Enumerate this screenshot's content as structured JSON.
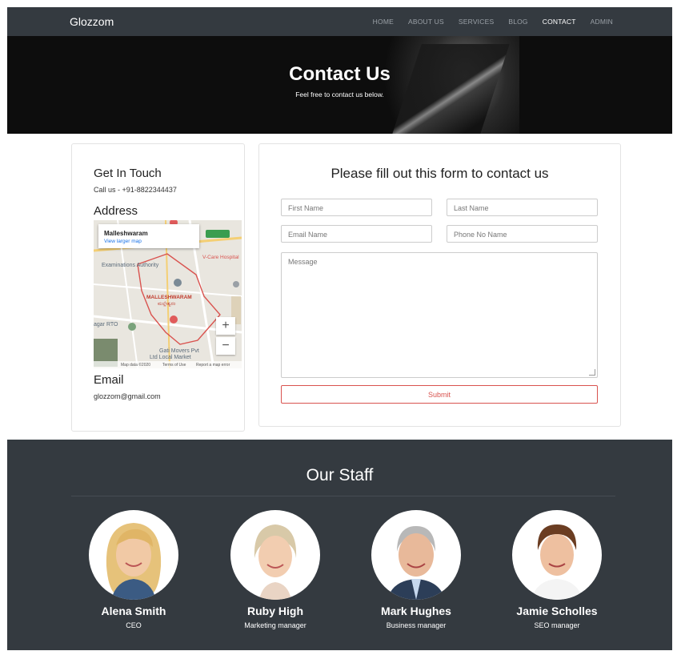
{
  "nav": {
    "brand": "Glozzom",
    "links": [
      "HOME",
      "ABOUT US",
      "SERVICES",
      "BLOG",
      "CONTACT",
      "ADMIN"
    ],
    "active": "CONTACT"
  },
  "hero": {
    "title": "Contact Us",
    "subtitle": "Feel free to contact us below."
  },
  "contact_info": {
    "get_in_touch_heading": "Get In Touch",
    "phone_text": "Call us - +91-8822344437",
    "address_heading": "Address",
    "email_heading": "Email",
    "email_value": "glozzom@gmail.com"
  },
  "map": {
    "place_name": "Malleshwaram",
    "larger_map_link": "View larger map",
    "area_label": "MALLESHWARAM",
    "area_label_local": "ಮಲ್ಲೇಶ್ವರಂ",
    "label_exam": "Examinations Authority",
    "label_hospital": "V-Care Hospital",
    "label_rto": "agar RTO",
    "label_market": "Gati Movers Pvt",
    "label_market2": "Ltd Local Market",
    "zoom_in": "+",
    "zoom_out": "−",
    "footer_data": "Map data ©2020",
    "footer_terms": "Terms of Use",
    "footer_report": "Report a map error"
  },
  "form": {
    "heading": "Please fill out this form to contact us",
    "first_name_placeholder": "First Name",
    "last_name_placeholder": "Last Name",
    "email_placeholder": "Email Name",
    "phone_placeholder": "Phone No Name",
    "message_placeholder": "Message",
    "submit_label": "Submit"
  },
  "staff": {
    "heading": "Our Staff",
    "members": [
      {
        "name": "Alena Smith",
        "role": "CEO"
      },
      {
        "name": "Ruby High",
        "role": "Marketing manager"
      },
      {
        "name": "Mark Hughes",
        "role": "Business manager"
      },
      {
        "name": "Jamie Scholles",
        "role": "SEO manager"
      }
    ]
  },
  "colors": {
    "navbar": "#343a40",
    "submit_border": "#d9534f",
    "staff_bg": "#343a40"
  }
}
